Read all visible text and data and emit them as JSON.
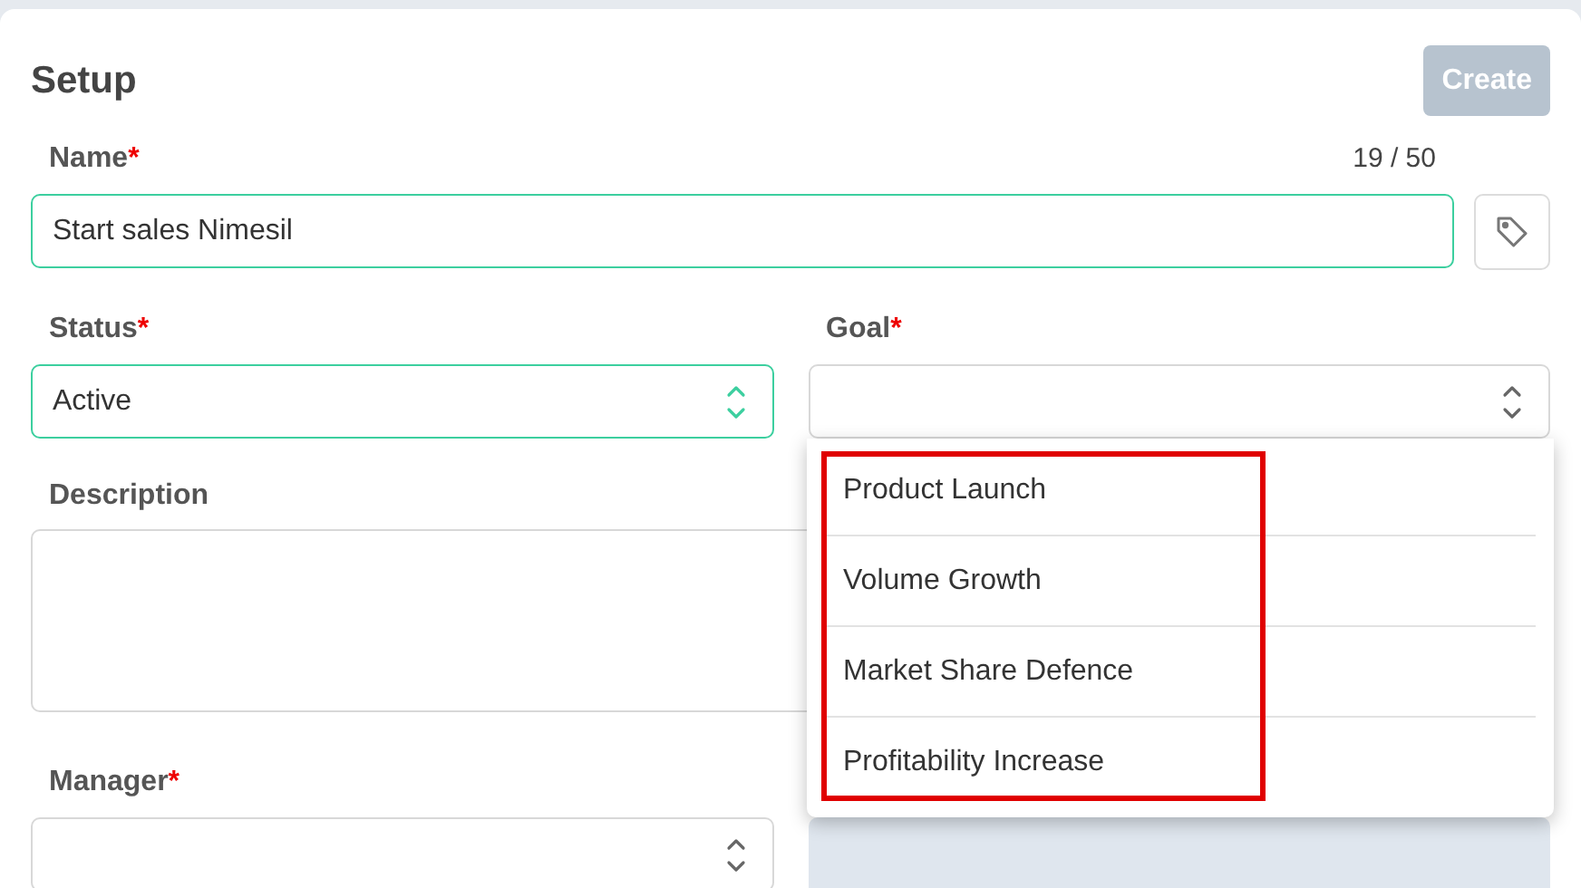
{
  "title": "Setup",
  "create_button": {
    "label": "Create",
    "disabled": true
  },
  "name_field": {
    "label": "Name",
    "required_mark": "*",
    "counter": "19 / 50",
    "value": "Start sales Nimesil",
    "focused": true
  },
  "status_select": {
    "label": "Status",
    "required_mark": "*",
    "value": "Active",
    "focused": true
  },
  "goal_select": {
    "label": "Goal",
    "required_mark": "*",
    "expanded": true,
    "options": [
      {
        "label": "Product Launch"
      },
      {
        "label": "Volume Growth"
      },
      {
        "label": "Market Share Defence"
      },
      {
        "label": "Profitability Increase"
      }
    ]
  },
  "description_field": {
    "label": "Description"
  },
  "manager_select": {
    "label": "Manager",
    "required_mark": "*",
    "focused": false
  },
  "highlight": {
    "shown": true
  }
}
